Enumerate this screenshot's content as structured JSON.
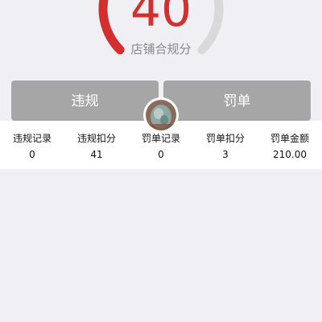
{
  "score": {
    "value": "40",
    "label": "店铺合规分",
    "fraction": 0.4,
    "track_color": "#d9d9d9",
    "fill_color": "#d32f2f"
  },
  "tabs": [
    {
      "label": "违规"
    },
    {
      "label": "罚单"
    }
  ],
  "stats": [
    {
      "label": "违规记录",
      "value": "0"
    },
    {
      "label": "违规扣分",
      "value": "41"
    },
    {
      "label": "罚单记录",
      "value": "0"
    },
    {
      "label": "罚单扣分",
      "value": "3"
    },
    {
      "label": "罚单金额",
      "value": "210.00"
    }
  ],
  "avatar": {
    "icon": "jade-pendant-photo"
  }
}
